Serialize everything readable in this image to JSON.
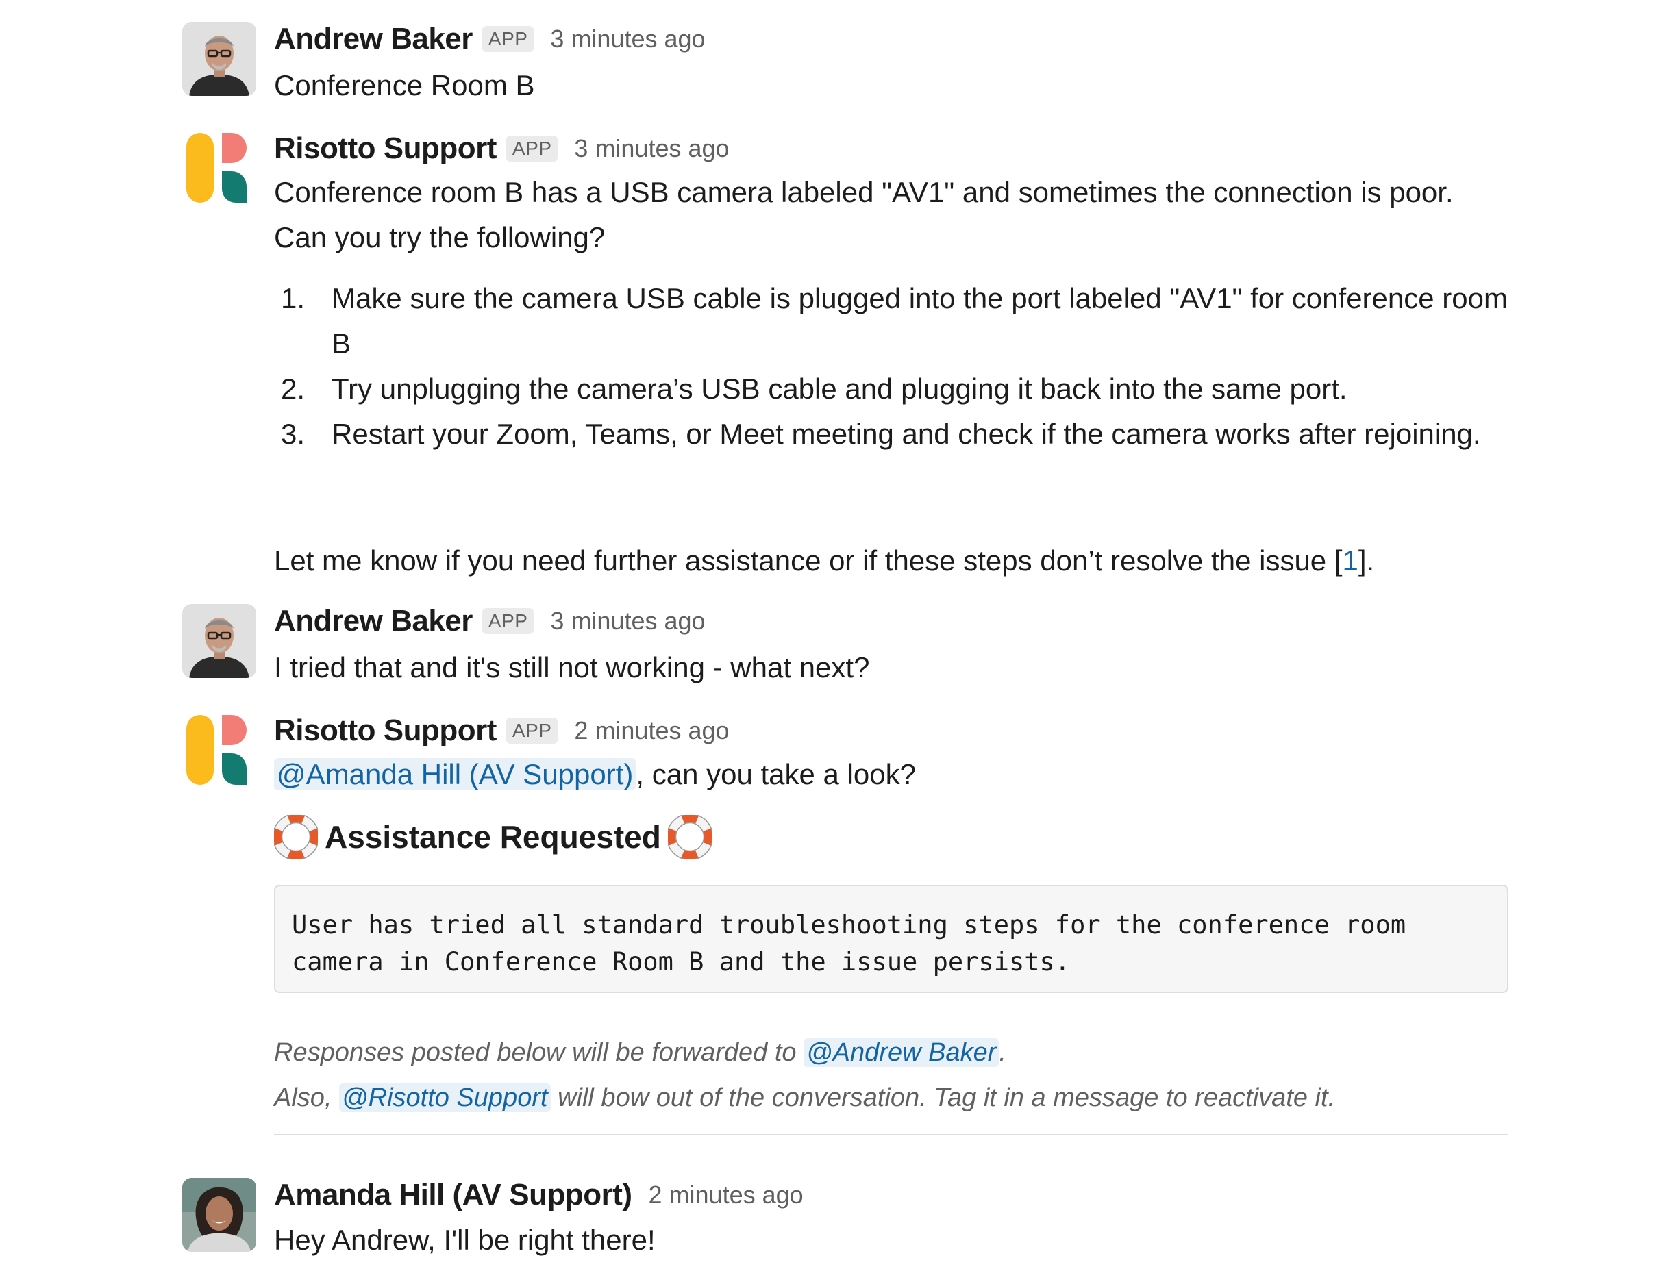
{
  "messages": [
    {
      "author": "Andrew Baker",
      "badge": "APP",
      "time": "3 minutes ago",
      "text": "Conference Room B"
    },
    {
      "author": "Risotto Support",
      "badge": "APP",
      "time": "3 minutes ago",
      "line1": "Conference room B has a USB camera labeled \"AV1\" and sometimes the connection is poor.",
      "line2": "Can you try the following?",
      "steps": [
        {
          "num": "1.",
          "text": "Make sure the camera USB cable is plugged into the port labeled \"AV1\" for conference room B"
        },
        {
          "num": "2.",
          "text": "Try unplugging the camera’s USB cable and plugging it back into the same port."
        },
        {
          "num": "3.",
          "text": "Restart your Zoom, Teams, or Meet meeting and check if the camera works after rejoining."
        }
      ],
      "closing_before": "Let me know if you need further assistance or if these steps don’t resolve the issue [",
      "citation": "1",
      "closing_after": "]."
    },
    {
      "author": "Andrew Baker",
      "badge": "APP",
      "time": "3 minutes ago",
      "text": "I tried that and it's still not working - what next?"
    },
    {
      "author": "Risotto Support",
      "badge": "APP",
      "time": "2 minutes ago",
      "mention": "@Amanda Hill (AV Support)",
      "mention_suffix": ", can you take a look?",
      "assist_icon": "lifebuoy-icon",
      "assist_title": "Assistance Requested",
      "code": "User has tried all standard troubleshooting steps for the conference room camera in Conference Room B and the issue persists.",
      "note1_before": "Responses posted below will be forwarded to ",
      "note1_mention": "@Andrew Baker",
      "note1_after": ".",
      "note2_before": "Also, ",
      "note2_mention": "@Risotto Support",
      "note2_after": " will bow out of the conversation. Tag it in a message to reactivate it."
    },
    {
      "author": "Amanda Hill (AV Support)",
      "time": "2 minutes ago",
      "text": "Hey Andrew, I'll be right there!"
    }
  ],
  "colors": {
    "link": "#1264a3",
    "mention_bg": "#e8f1f8",
    "logo_yellow": "#fcbb1c",
    "logo_pink": "#f27d77",
    "logo_teal": "#137b6f",
    "muted": "#616061"
  }
}
